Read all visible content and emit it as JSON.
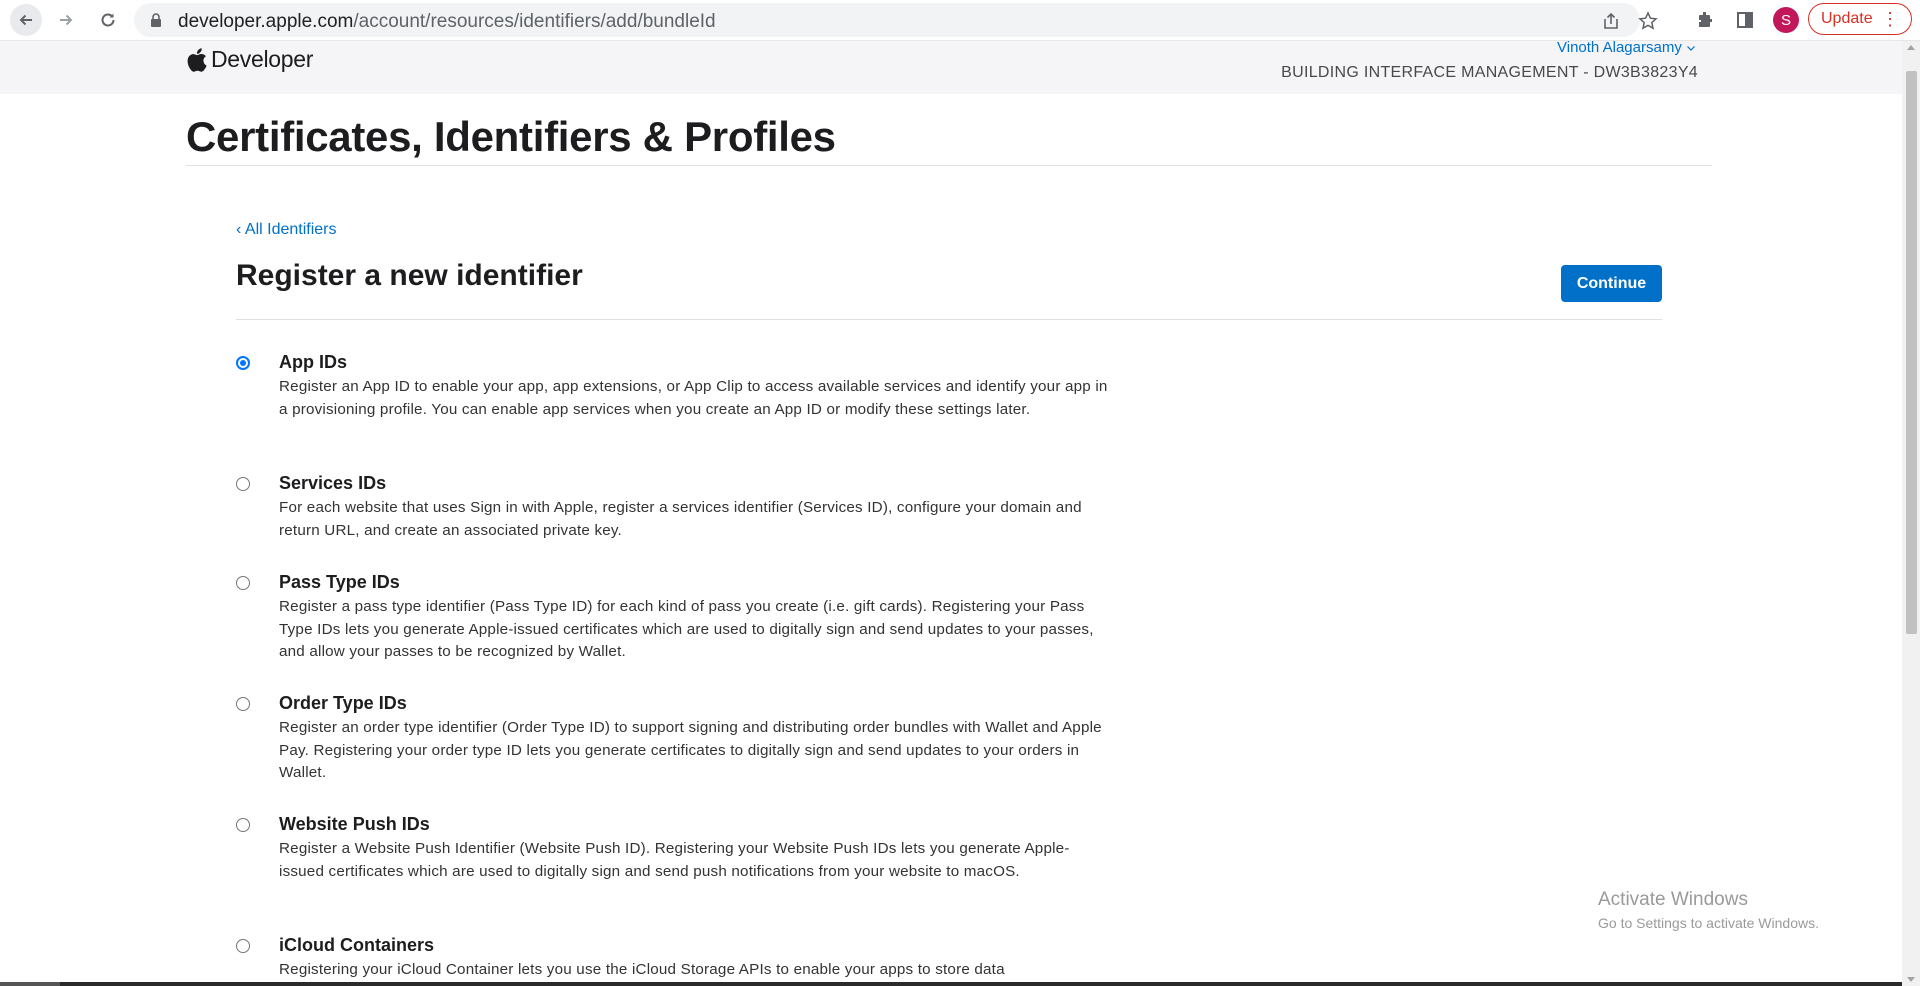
{
  "browser": {
    "url_host": "developer.apple.com",
    "url_path": "/account/resources/identifiers/add/bundleId",
    "profile_initial": "S",
    "update_label": "Update"
  },
  "header": {
    "logo_text": "Developer",
    "user_name": "Vinoth Alagarsamy",
    "team_name": "BUILDING INTERFACE MANAGEMENT - DW3B3823Y4"
  },
  "page": {
    "title": "Certificates, Identifiers & Profiles",
    "back_link": "‹ All Identifiers",
    "section_title": "Register a new identifier",
    "continue_label": "Continue"
  },
  "options": [
    {
      "title": "App IDs",
      "description": "Register an App ID to enable your app, app extensions, or App Clip to access available services and identify your app in a provisioning profile. You can enable app services when you create an App ID or modify these settings later.",
      "selected": true
    },
    {
      "title": "Services IDs",
      "description": "For each website that uses Sign in with Apple, register a services identifier (Services ID), configure your domain and return URL, and create an associated private key.",
      "selected": false
    },
    {
      "title": "Pass Type IDs",
      "description": "Register a pass type identifier (Pass Type ID) for each kind of pass you create (i.e. gift cards). Registering your Pass Type IDs lets you generate Apple-issued certificates which are used to digitally sign and send updates to your passes, and allow your passes to be recognized by Wallet.",
      "selected": false
    },
    {
      "title": "Order Type IDs",
      "description": "Register an order type identifier (Order Type ID) to support signing and distributing order bundles with Wallet and Apple Pay. Registering your order type ID lets you generate certificates to digitally sign and send updates to your orders in Wallet.",
      "selected": false
    },
    {
      "title": "Website Push IDs",
      "description": "Register a Website Push Identifier (Website Push ID). Registering your Website Push IDs lets you generate Apple-issued certificates which are used to digitally sign and send push notifications from your website to macOS.",
      "selected": false
    },
    {
      "title": "iCloud Containers",
      "description": "Registering your iCloud Container lets you use the iCloud Storage APIs to enable your apps to store data",
      "selected": false
    }
  ],
  "watermark": {
    "line1": "Activate Windows",
    "line2": "Go to Settings to activate Windows."
  },
  "colors": {
    "accent": "#0070c9",
    "update": "#d93025",
    "profile": "#c2185b"
  }
}
